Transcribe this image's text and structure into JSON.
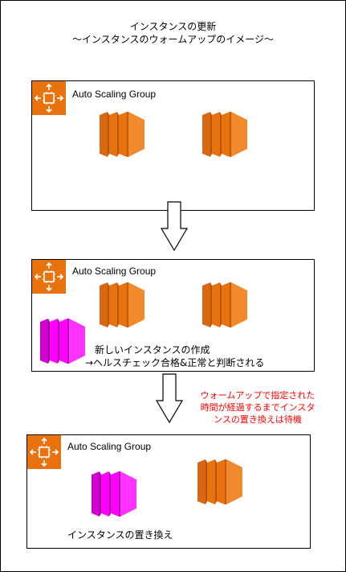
{
  "header": {
    "title": "インスタンスの更新",
    "subtitle": "～インスタンスのウォームアップのイメージ～"
  },
  "panels": [
    {
      "asg_label": "Auto Scaling Group"
    },
    {
      "asg_label": "Auto Scaling Group",
      "caption_line1": "新しいインスタンスの作成",
      "caption_line2": "→ヘルスチェック合格&正常と判断される"
    },
    {
      "asg_label": "Auto Scaling Group",
      "caption": "インスタンスの置き換え"
    }
  ],
  "note": {
    "line1": "ウォームアップで指定された",
    "line2": "時間が経過するまでインスタ",
    "line3": "ンスの置き換えは待機"
  },
  "colors": {
    "asg_orange": "#e8720c",
    "instance_orange": "#f08a2c",
    "new_instance_magenta": "#ff00ff",
    "note_red": "#ff0000"
  },
  "icons": [
    "auto-scaling-group-icon",
    "ec2-instance-icon"
  ]
}
